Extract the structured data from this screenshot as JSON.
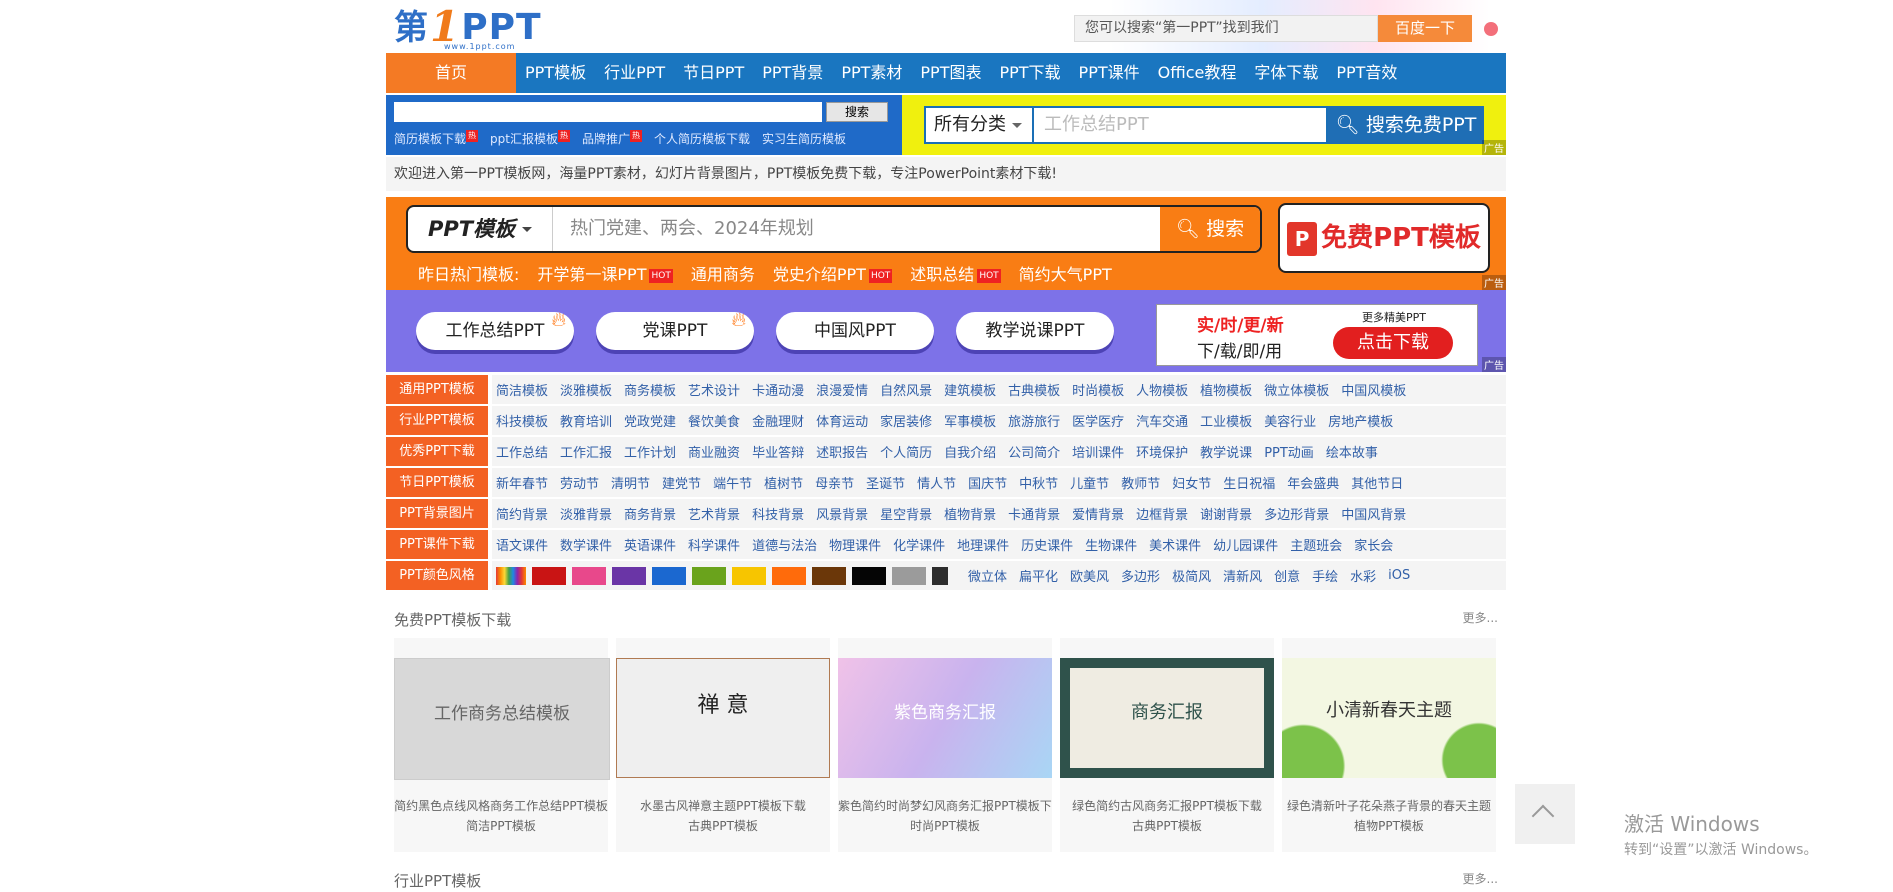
{
  "header": {
    "logo_di": "第",
    "logo_one": "1",
    "logo_ppt": "PPT",
    "logo_sub": "www.1ppt.com",
    "search_placeholder": "您可以搜索“第一PPT”找到我们",
    "search_button": "百度一下"
  },
  "nav": {
    "items": [
      "首页",
      "PPT模板",
      "行业PPT",
      "节日PPT",
      "PPT背景",
      "PPT素材",
      "PPT图表",
      "PPT下载",
      "PPT课件",
      "Office教程",
      "字体下载",
      "PPT音效"
    ]
  },
  "search_ad": {
    "button": "搜索",
    "links": [
      "简历模板下载",
      "ppt汇报模板",
      "品牌推广",
      "个人简历模板下载",
      "实习生简历模板"
    ],
    "hot": "热",
    "category": "所有分类",
    "placeholder": "工作总结PPT",
    "submit": "搜索免费PPT",
    "ad_tag": "广告"
  },
  "welcome": "欢迎进入第一PPT模板网，海量PPT素材，幻灯片背景图片，PPT模板免费下载，专注PowerPoint素材下载!",
  "orange_banner": {
    "category": "PPT模板",
    "placeholder": "热门党建、两会、2024年规划",
    "search": "搜索",
    "free_label": "免费PPT模板",
    "free_icon": "P",
    "hot_prefix": "昨日热门模板:",
    "hot_items": [
      {
        "label": "开学第一课PPT",
        "hot": true
      },
      {
        "label": "通用商务",
        "hot": false
      },
      {
        "label": "党史介绍PPT",
        "hot": true
      },
      {
        "label": "述职总结",
        "hot": true
      },
      {
        "label": "简约大气PPT",
        "hot": false
      }
    ],
    "hot_badge": "HOT"
  },
  "purple_banner": {
    "pills": [
      "工作总结PPT",
      "党课PPT",
      "中国风PPT",
      "教学说课PPT"
    ],
    "box_line1": "实/时/更/新",
    "box_line2": "下/载/即/用",
    "box_more": "更多精美PPT",
    "box_cta": "点击下载"
  },
  "categories": [
    {
      "label": "通用PPT模板",
      "links": [
        "简洁模板",
        "淡雅模板",
        "商务模板",
        "艺术设计",
        "卡通动漫",
        "浪漫爱情",
        "自然风景",
        "建筑模板",
        "古典模板",
        "时尚模板",
        "人物模板",
        "植物模板",
        "微立体模板",
        "中国风模板"
      ]
    },
    {
      "label": "行业PPT模板",
      "links": [
        "科技模板",
        "教育培训",
        "党政党建",
        "餐饮美食",
        "金融理财",
        "体育运动",
        "家居装修",
        "军事模板",
        "旅游旅行",
        "医学医疗",
        "汽车交通",
        "工业模板",
        "美容行业",
        "房地产模板"
      ]
    },
    {
      "label": "优秀PPT下载",
      "links": [
        "工作总结",
        "工作汇报",
        "工作计划",
        "商业融资",
        "毕业答辩",
        "述职报告",
        "个人简历",
        "自我介绍",
        "公司简介",
        "培训课件",
        "环境保护",
        "教学说课",
        "PPT动画",
        "绘本故事"
      ]
    },
    {
      "label": "节日PPT模板",
      "links": [
        "新年春节",
        "劳动节",
        "清明节",
        "建党节",
        "端午节",
        "植树节",
        "母亲节",
        "圣诞节",
        "情人节",
        "国庆节",
        "中秋节",
        "儿童节",
        "教师节",
        "妇女节",
        "生日祝福",
        "年会盛典",
        "其他节日"
      ]
    },
    {
      "label": "PPT背景图片",
      "links": [
        "简约背景",
        "淡雅背景",
        "商务背景",
        "艺术背景",
        "科技背景",
        "风景背景",
        "星空背景",
        "植物背景",
        "卡通背景",
        "爱情背景",
        "边框背景",
        "谢谢背景",
        "多边形背景",
        "中国风背景"
      ]
    },
    {
      "label": "PPT课件下载",
      "links": [
        "语文课件",
        "数学课件",
        "英语课件",
        "科学课件",
        "道德与法治",
        "物理课件",
        "化学课件",
        "地理课件",
        "历史课件",
        "生物课件",
        "美术课件",
        "幼儿园课件",
        "主题班会",
        "家长会"
      ]
    }
  ],
  "colors_row": {
    "label": "PPT颜色风格",
    "swatches": [
      "#e64b3c",
      "#c91414",
      "#e8488b",
      "#6a35a6",
      "#1b68d0",
      "#6aa31c",
      "#f7c500",
      "#ff6b0b",
      "#6b3709",
      "#050505",
      "#9b9b9b",
      "#2d2d2d"
    ],
    "links": [
      "微立体",
      "扁平化",
      "欧美风",
      "多边形",
      "极简风",
      "清新风",
      "创意",
      "手绘",
      "水彩",
      "iOS"
    ]
  },
  "section_free": {
    "title": "免费PPT模板下载",
    "more": "更多...",
    "cards": [
      {
        "title": "简约黑色点线风格商务工作总结PPT模板",
        "cat": "简洁PPT模板",
        "img_text": "工作商务总结模板",
        "theme": "#d8d8d8"
      },
      {
        "title": "水墨古风禅意主题PPT模板下载",
        "cat": "古典PPT模板",
        "img_text": "禅 意",
        "theme": "#efefef"
      },
      {
        "title": "紫色简约时尚梦幻风商务汇报PPT模板下载",
        "cat": "时尚PPT模板",
        "img_text": "紫色商务汇报",
        "theme": "#d6b4ea"
      },
      {
        "title": "绿色简约古风商务汇报PPT模板下载",
        "cat": "古典PPT模板",
        "img_text": "商务汇报",
        "theme": "#2f524b"
      },
      {
        "title": "绿色清新叶子花朵燕子背景的春天主题",
        "cat": "植物PPT模板",
        "img_text": "小清新春天主题",
        "theme": "#f3f7e2"
      }
    ]
  },
  "section_industry": {
    "title": "行业PPT模板",
    "more": "更多..."
  },
  "windows": {
    "line1": "激活 Windows",
    "line2": "转到“设置”以激活 Windows。"
  }
}
